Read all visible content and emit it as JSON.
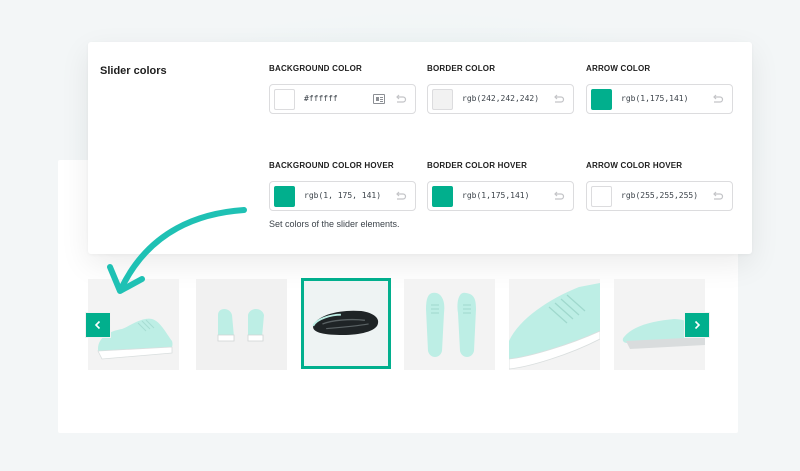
{
  "panel": {
    "title": "Slider colors",
    "help_text": "Set colors of the slider elements."
  },
  "fields": [
    {
      "label": "BACKGROUND COLOR",
      "value": "#ffffff",
      "swatch": "#ffffff",
      "has_picker_icon": true
    },
    {
      "label": "BORDER COLOR",
      "value": "rgb(242,242,242)",
      "swatch": "#f2f2f2",
      "has_picker_icon": false
    },
    {
      "label": "ARROW COLOR",
      "value": "rgb(1,175,141)",
      "swatch": "#01af8d",
      "has_picker_icon": false
    },
    {
      "label": "BACKGROUND COLOR HOVER",
      "value": "rgb(1, 175, 141)",
      "swatch": "#01af8d",
      "has_picker_icon": false
    },
    {
      "label": "BORDER COLOR HOVER",
      "value": "rgb(1,175,141)",
      "swatch": "#01af8d",
      "has_picker_icon": false
    },
    {
      "label": "ARROW COLOR HOVER",
      "value": "rgb(255,255,255)",
      "swatch": "#ffffff",
      "has_picker_icon": false
    }
  ],
  "colors": {
    "accent": "#01af8d",
    "arrow_curve": "#1fc1b4",
    "shoe_mint": "#bdeee5"
  },
  "slider": {
    "thumbnails": [
      {
        "icon": "shoe-side-view-icon",
        "active": false
      },
      {
        "icon": "shoe-pair-back-view-icon",
        "active": false
      },
      {
        "icon": "shoe-sole-view-icon",
        "active": true
      },
      {
        "icon": "shoe-pair-top-view-icon",
        "active": false
      },
      {
        "icon": "shoe-closeup-icon",
        "active": false
      },
      {
        "icon": "shoe-side-view-icon",
        "active": false
      }
    ],
    "prev_icon": "chevron-left-icon",
    "next_icon": "chevron-right-icon"
  }
}
